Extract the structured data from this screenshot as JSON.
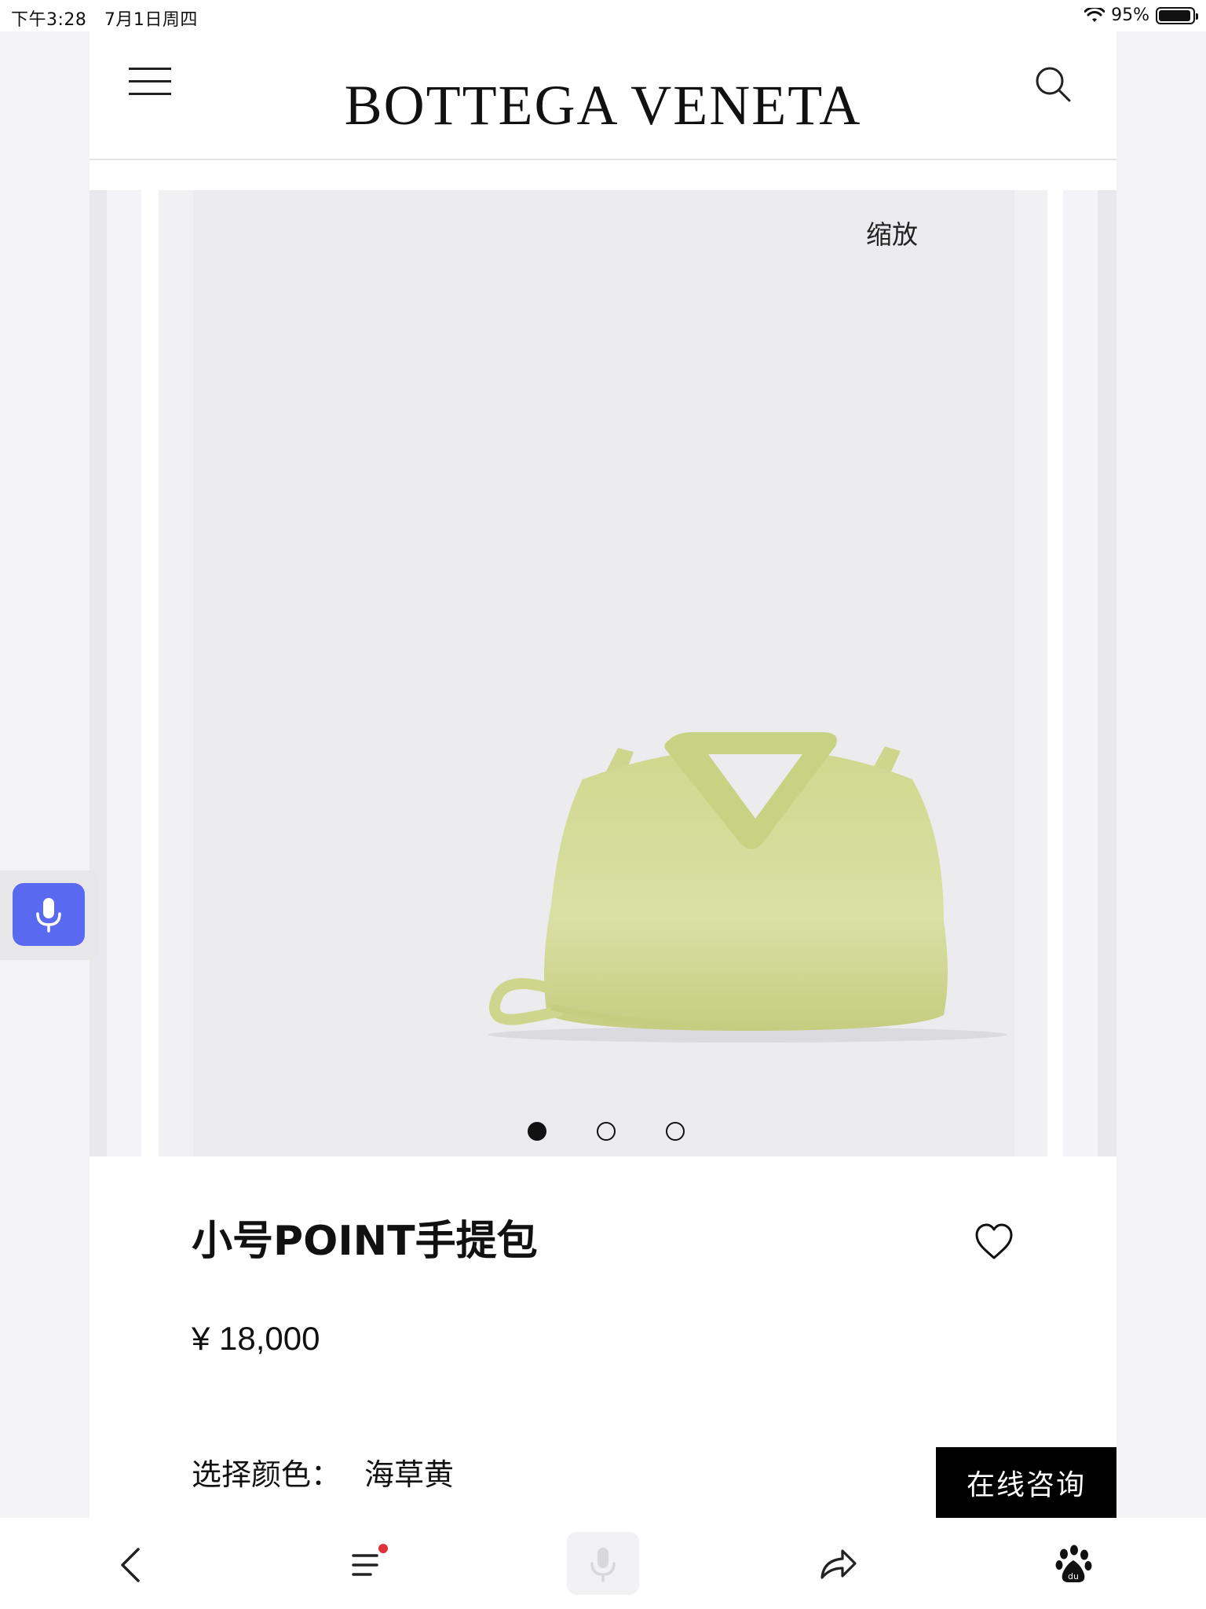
{
  "status_bar": {
    "time": "下午3:28",
    "date": "7月1日周四",
    "battery_percent": "95%",
    "battery_level": 0.95
  },
  "header": {
    "logo": "BOTTEGA VENETA",
    "menu_icon": "hamburger-menu-icon",
    "search_icon": "search-icon"
  },
  "gallery": {
    "zoom_label": "缩放",
    "slide_count": 3,
    "active_slide": 1,
    "product_color": "#d6dea0"
  },
  "product": {
    "title": "小号POINT手提包",
    "price": "¥ 18,000",
    "color_label": "选择颜色：",
    "color_value": "海草黄"
  },
  "consult_button": "在线咨询",
  "voice_button_color": "#5a6af0",
  "bottom_bar": {
    "icons": [
      "back-icon",
      "list-menu-icon",
      "mic-icon",
      "share-icon",
      "baidu-paw-icon"
    ],
    "notification_dot_color": "#e0303a"
  }
}
